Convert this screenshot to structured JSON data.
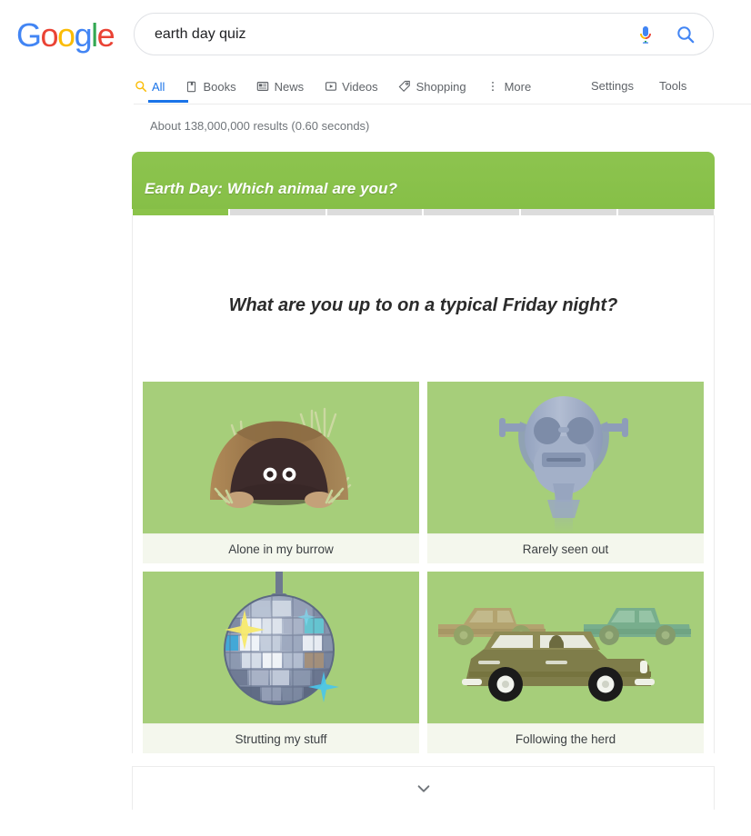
{
  "brand": {
    "name": "Google",
    "letters": [
      {
        "ch": "G",
        "color": "#4285F4"
      },
      {
        "ch": "o",
        "color": "#EA4335"
      },
      {
        "ch": "o",
        "color": "#FBBC05"
      },
      {
        "ch": "g",
        "color": "#4285F4"
      },
      {
        "ch": "l",
        "color": "#34A853"
      },
      {
        "ch": "e",
        "color": "#EA4335"
      }
    ]
  },
  "search": {
    "query": "earth day quiz",
    "placeholder": "Search",
    "mic_icon": "microphone-icon",
    "search_icon": "search-icon"
  },
  "nav": {
    "tabs": [
      {
        "label": "All",
        "icon": "search-icon",
        "active": true
      },
      {
        "label": "Books",
        "icon": "book-icon",
        "active": false
      },
      {
        "label": "News",
        "icon": "newspaper-icon",
        "active": false
      },
      {
        "label": "Videos",
        "icon": "video-icon",
        "active": false
      },
      {
        "label": "Shopping",
        "icon": "tag-icon",
        "active": false
      },
      {
        "label": "More",
        "icon": "more-vertical-icon",
        "active": false
      }
    ],
    "right": [
      {
        "label": "Settings"
      },
      {
        "label": "Tools"
      }
    ]
  },
  "results": {
    "stats": "About 138,000,000 results (0.60 seconds)"
  },
  "quiz": {
    "title": "Earth Day: Which animal are you?",
    "question": "What are you up to on a typical Friday night?",
    "progress": {
      "total_segments": 6,
      "completed_segments": 1,
      "fill_color": "#8bc34a",
      "track_color": "#dcdcdc"
    },
    "header_color": "#8dc44f",
    "tile_color": "#a6ce7a",
    "answers": [
      {
        "label": "Alone in my burrow",
        "art": "burrow-animal-art"
      },
      {
        "label": "Rarely seen out",
        "art": "tower-viewer-art"
      },
      {
        "label": "Strutting my stuff",
        "art": "disco-ball-art"
      },
      {
        "label": "Following the herd",
        "art": "cars-herd-art"
      }
    ],
    "expand_icon": "chevron-down-icon"
  }
}
